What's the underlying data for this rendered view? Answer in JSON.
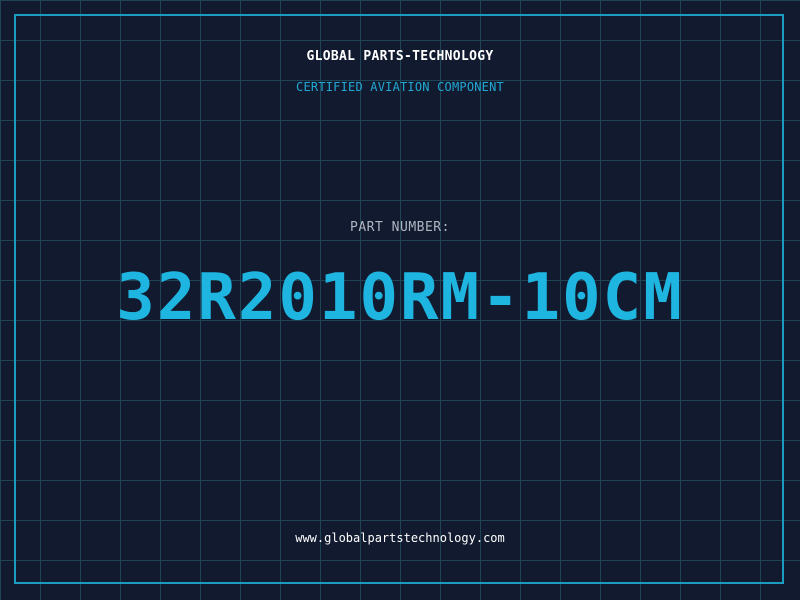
{
  "header": {
    "company": "GLOBAL PARTS-TECHNOLOGY",
    "subtitle": "CERTIFIED AVIATION COMPONENT"
  },
  "part": {
    "label": "PART NUMBER:",
    "number": "32R2010RM-10CM"
  },
  "footer": {
    "url": "www.globalpartstechnology.com"
  },
  "colors": {
    "background": "#121a2f",
    "grid": "#1f4456",
    "accent": "#1eb6e0",
    "frame": "#1b9cc0"
  }
}
